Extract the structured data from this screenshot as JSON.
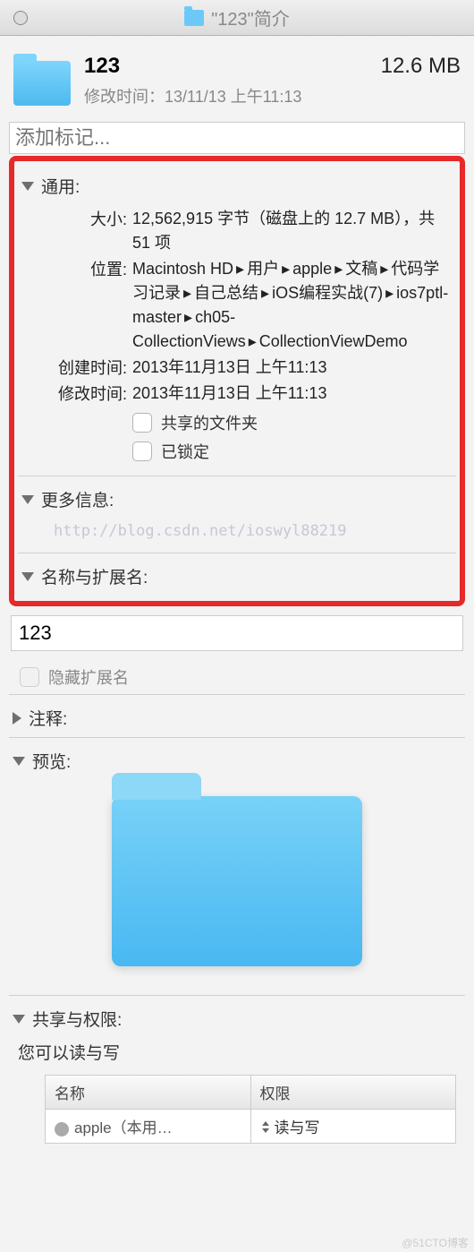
{
  "titlebar": {
    "title": "\"123\"简介"
  },
  "header": {
    "name": "123",
    "size": "12.6 MB",
    "mod_label": "修改时间：",
    "mod_value": "13/11/13 上午11:13"
  },
  "tags": {
    "placeholder": "添加标记..."
  },
  "sections": {
    "general": {
      "title": "通用:"
    },
    "more_info": {
      "title": "更多信息:"
    },
    "name_ext": {
      "title": "名称与扩展名:"
    },
    "comments": {
      "title": "注释:"
    },
    "preview": {
      "title": "预览:"
    },
    "sharing": {
      "title": "共享与权限:"
    }
  },
  "general": {
    "size_label": "大小:",
    "size_value": "12,562,915 字节（磁盘上的 12.7 MB），共 51 项",
    "location_label": "位置:",
    "location_parts": [
      "Macintosh HD",
      "用户",
      "apple",
      "文稿",
      "代码学习记录",
      "自己总结",
      "iOS编程实战(7)",
      "ios7ptl-master",
      "ch05-CollectionViews",
      "CollectionViewDemo"
    ],
    "created_label": "创建时间:",
    "created_value": "2013年11月13日 上午11:13",
    "modified_label": "修改时间:",
    "modified_value": "2013年11月13日 上午11:13",
    "shared_folder_label": "共享的文件夹",
    "locked_label": "已锁定"
  },
  "watermark": "http://blog.csdn.net/ioswyl88219",
  "name_ext": {
    "value": "123",
    "hide_ext_label": "隐藏扩展名"
  },
  "sharing": {
    "desc": "您可以读与写",
    "col_name": "名称",
    "col_priv": "权限",
    "rows": [
      {
        "name": "apple（本用…",
        "priv": "读与写"
      }
    ]
  },
  "footer": "@51CTO博客"
}
